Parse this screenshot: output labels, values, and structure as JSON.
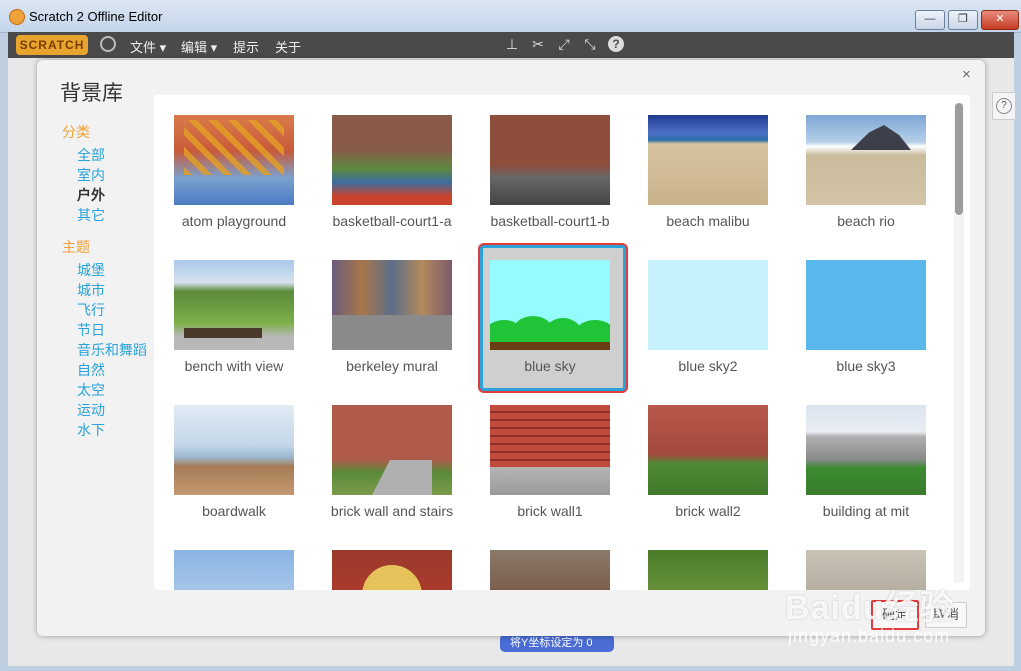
{
  "window": {
    "title": "Scratch 2 Offline Editor",
    "min": "—",
    "max": "❐",
    "close": "✕"
  },
  "menubar": {
    "logo": "SCRATCH",
    "items": [
      "文件 ▾",
      "编辑 ▾",
      "提示",
      "关于"
    ],
    "tools": [
      "stamp-icon",
      "cut-icon",
      "grow-icon",
      "shrink-icon"
    ],
    "help": "?"
  },
  "dialog": {
    "title": "背景库",
    "close": "×",
    "categories_heading": "分类",
    "categories": [
      "全部",
      "室内",
      "户外",
      "其它"
    ],
    "selected_category": "户外",
    "themes_heading": "主题",
    "themes": [
      "城堡",
      "城市",
      "飞行",
      "节日",
      "音乐和舞蹈",
      "自然",
      "太空",
      "运动",
      "水下"
    ],
    "items": [
      {
        "label": "atom playground"
      },
      {
        "label": "basketball-court1-a"
      },
      {
        "label": "basketball-court1-b"
      },
      {
        "label": "beach malibu"
      },
      {
        "label": "beach rio"
      },
      {
        "label": "bench with view"
      },
      {
        "label": "berkeley mural"
      },
      {
        "label": "blue sky",
        "selected": true
      },
      {
        "label": "blue sky2"
      },
      {
        "label": "blue sky3"
      },
      {
        "label": "boardwalk"
      },
      {
        "label": "brick wall and stairs"
      },
      {
        "label": "brick wall1"
      },
      {
        "label": "brick wall2"
      },
      {
        "label": "building at mit"
      }
    ],
    "ok_label": "确定",
    "cancel_label": "取消"
  },
  "background": {
    "block_label": "将Y坐标设定为 0",
    "side_help": "?"
  },
  "watermark": {
    "main": "Baidu经验",
    "sub": "jingyan.baidu.com"
  },
  "colors": {
    "accent": "#29a3d9",
    "heading": "#f0a030",
    "highlight": "#e23b3b"
  }
}
